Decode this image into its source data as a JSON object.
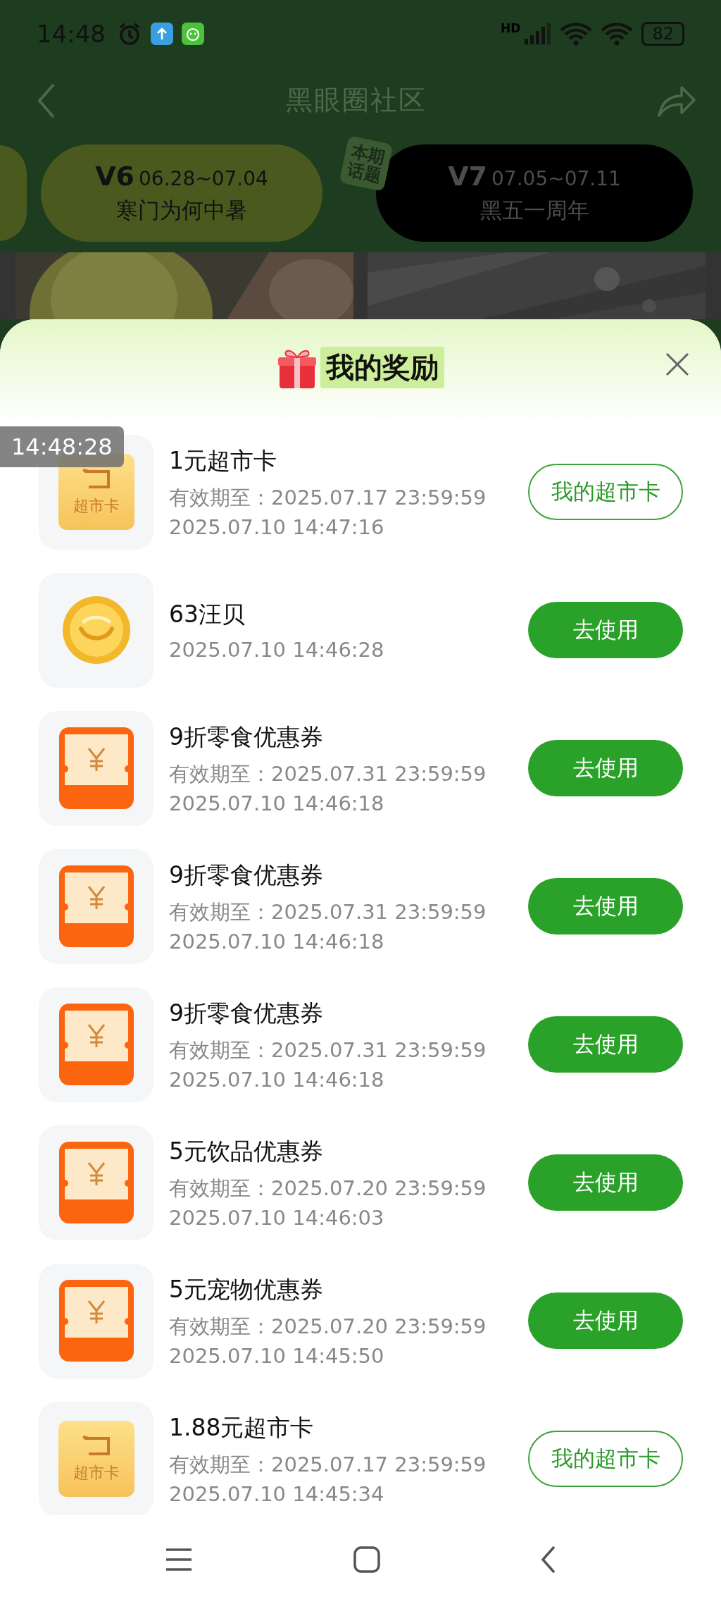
{
  "status_bar": {
    "time": "14:48",
    "network": "HD",
    "battery": "82"
  },
  "nav": {
    "title": "黑眼圈社区"
  },
  "periods": [
    {
      "version": "V6",
      "dates": "06.28~07.04",
      "topic": "寒门为何中暑",
      "selected": false
    },
    {
      "version": "V7",
      "dates": "07.05~07.11",
      "topic": "黑五一周年",
      "selected": true,
      "badge": "本期话题"
    }
  ],
  "rewards": {
    "title": "我的奖励",
    "items": [
      {
        "kind": "card",
        "icon_label": "超市卡",
        "name": "1元超市卡",
        "lines": [
          "有效期至：2025.07.17 23:59:59",
          "2025.07.10 14:47:16"
        ],
        "button": {
          "label": "我的超市卡",
          "kind": "outline"
        }
      },
      {
        "kind": "coin",
        "name": "63汪贝",
        "lines": [
          "2025.07.10 14:46:28"
        ],
        "button": {
          "label": "去使用",
          "kind": "filled"
        }
      },
      {
        "kind": "coupon",
        "name": "9折零食优惠券",
        "lines": [
          "有效期至：2025.07.31 23:59:59",
          "2025.07.10 14:46:18"
        ],
        "button": {
          "label": "去使用",
          "kind": "filled"
        }
      },
      {
        "kind": "coupon",
        "name": "9折零食优惠券",
        "lines": [
          "有效期至：2025.07.31 23:59:59",
          "2025.07.10 14:46:18"
        ],
        "button": {
          "label": "去使用",
          "kind": "filled"
        }
      },
      {
        "kind": "coupon",
        "name": "9折零食优惠券",
        "lines": [
          "有效期至：2025.07.31 23:59:59",
          "2025.07.10 14:46:18"
        ],
        "button": {
          "label": "去使用",
          "kind": "filled"
        }
      },
      {
        "kind": "coupon",
        "name": "5元饮品优惠券",
        "lines": [
          "有效期至：2025.07.20 23:59:59",
          "2025.07.10 14:46:03"
        ],
        "button": {
          "label": "去使用",
          "kind": "filled"
        }
      },
      {
        "kind": "coupon",
        "name": "5元宠物优惠券",
        "lines": [
          "有效期至：2025.07.20 23:59:59",
          "2025.07.10 14:45:50"
        ],
        "button": {
          "label": "去使用",
          "kind": "filled"
        }
      },
      {
        "kind": "card",
        "icon_label": "超市卡",
        "name": "1.88元超市卡",
        "lines": [
          "有效期至：2025.07.17 23:59:59",
          "2025.07.10 14:45:34"
        ],
        "button": {
          "label": "我的超市卡",
          "kind": "outline"
        }
      }
    ]
  },
  "overlay_time": "14:48:28"
}
